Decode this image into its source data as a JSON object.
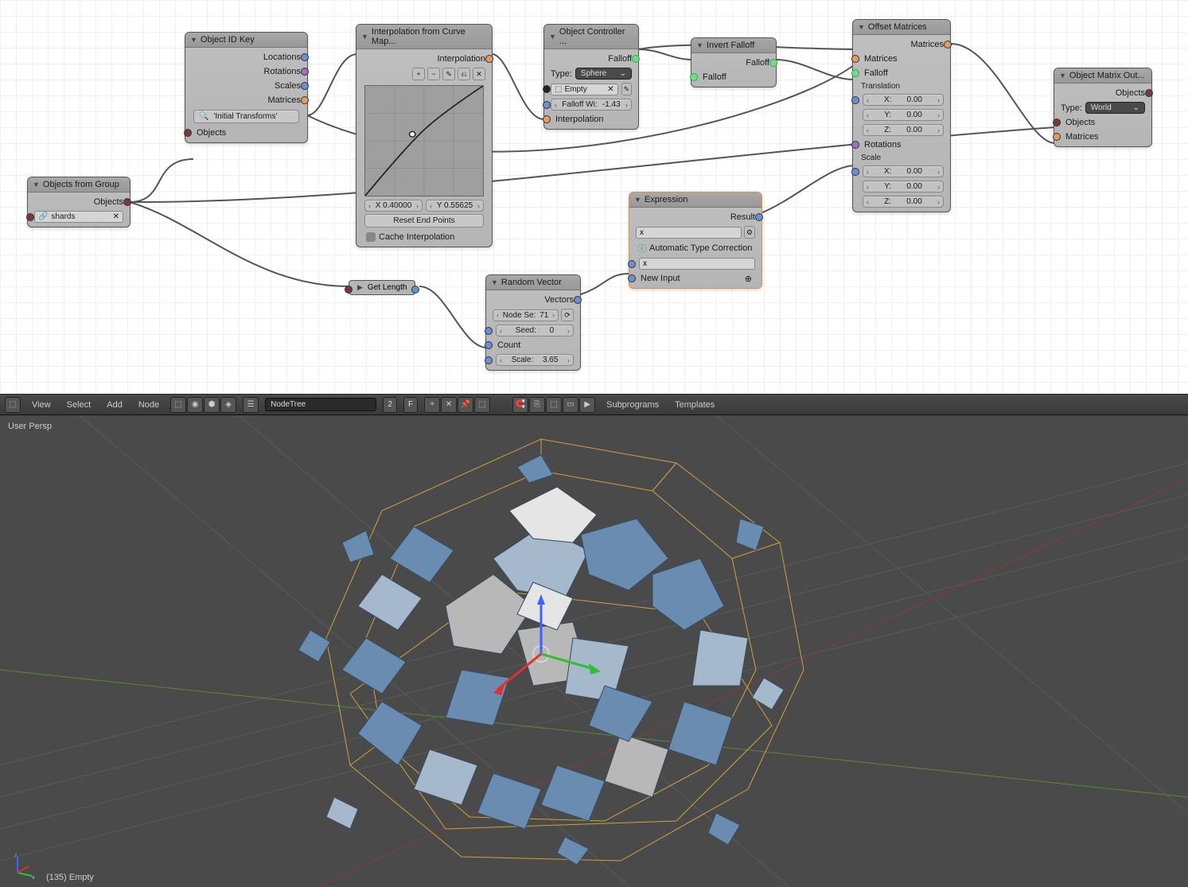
{
  "nodes": {
    "objects_from_group": {
      "title": "Objects from Group",
      "out_objects": "Objects",
      "group_field": "shards"
    },
    "object_id_key": {
      "title": "Object ID Key",
      "out_locations": "Locations",
      "out_rotations": "Rotations",
      "out_scales": "Scales",
      "out_matrices": "Matrices",
      "key_btn": "'Initial Transforms'",
      "in_objects": "Objects"
    },
    "interpolation": {
      "title": "Interpolation from Curve Map...",
      "out_interpolation": "Interpolation",
      "coord_x": "X 0.40000",
      "coord_y": "Y 0.55625",
      "reset_btn": "Reset End Points",
      "cache_label": "Cache Interpolation"
    },
    "object_controller": {
      "title": "Object Controller ...",
      "out_falloff": "Falloff",
      "type_label": "Type:",
      "type_value": "Sphere",
      "obj_field": "Empty",
      "falloff_width_label": "Falloff Wi:",
      "falloff_width_value": "-1.43",
      "in_interpolation": "Interpolation"
    },
    "invert_falloff": {
      "title": "Invert Falloff",
      "out_falloff": "Falloff",
      "in_falloff": "Falloff"
    },
    "offset_matrices": {
      "title": "Offset Matrices",
      "out_matrices": "Matrices",
      "in_matrices": "Matrices",
      "in_falloff": "Falloff",
      "translation": "Translation",
      "rotations": "Rotations",
      "scale": "Scale",
      "x": "X:",
      "y": "Y:",
      "z": "Z:",
      "zero": "0.00"
    },
    "object_matrix_out": {
      "title": "Object Matrix Out...",
      "out_objects": "Objects",
      "type_label": "Type:",
      "type_value": "World",
      "in_objects": "Objects",
      "in_matrices": "Matrices"
    },
    "get_length": {
      "label": "Get Length"
    },
    "random_vector": {
      "title": "Random Vector",
      "out_vectors": "Vectors",
      "nodeseed_label": "Node Se:",
      "nodeseed_value": "71",
      "seed_label": "Seed:",
      "seed_value": "0",
      "count_label": "Count",
      "scale_label": "Scale:",
      "scale_value": "3.65"
    },
    "expression": {
      "title": "Expression",
      "out_result": "Result",
      "expr_value": "x",
      "auto_label": "Automatic Type Correction",
      "input_x": "x",
      "new_input": "New Input"
    }
  },
  "header": {
    "menu_view": "View",
    "menu_select": "Select",
    "menu_add": "Add",
    "menu_node": "Node",
    "nodetree": "NodeTree",
    "users": "2",
    "f": "F",
    "subprograms": "Subprograms",
    "templates": "Templates"
  },
  "viewport": {
    "label_tl": "User Persp",
    "label_bl": "(135) Empty"
  }
}
